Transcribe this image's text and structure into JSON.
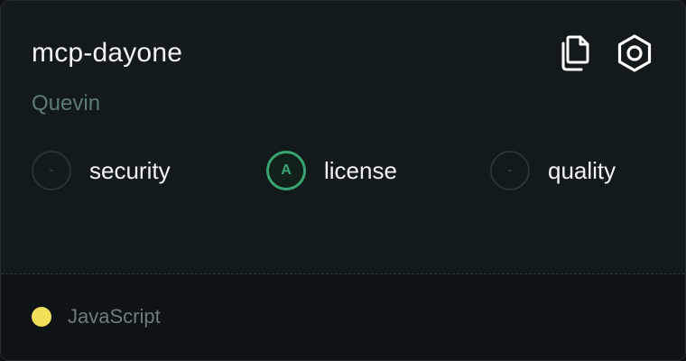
{
  "card": {
    "title": "mcp-dayone",
    "author": "Quevin",
    "actions": [
      {
        "icon": "copy-icon"
      },
      {
        "icon": "settings-icon"
      }
    ],
    "metrics": [
      {
        "badge": "-",
        "label": "security",
        "state": "none"
      },
      {
        "badge": "A",
        "label": "license",
        "state": "graded",
        "color": "#3aa372"
      },
      {
        "badge": "-",
        "label": "quality",
        "state": "none"
      }
    ],
    "language": {
      "name": "JavaScript",
      "color": "#f1e05a"
    }
  }
}
